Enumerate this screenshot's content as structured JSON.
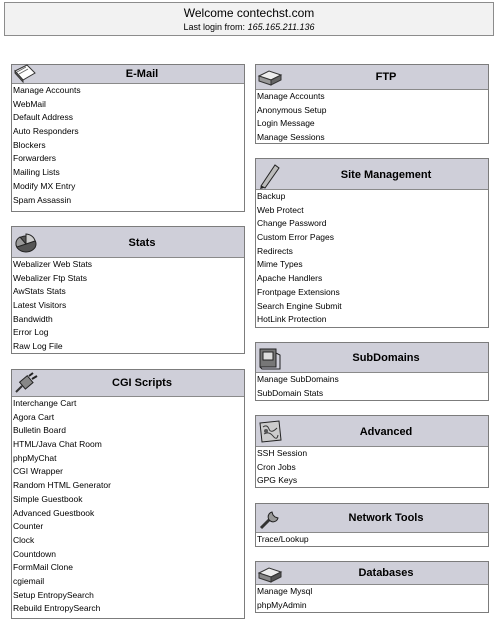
{
  "welcome": {
    "line1": "Welcome contechst.com",
    "line2_prefix": "Last login from:",
    "ip": "165.165.211.136"
  },
  "panels": {
    "email": {
      "title": "E-Mail",
      "icon": "envelope-icon",
      "items": [
        "Manage Accounts",
        "WebMail",
        "Default Address",
        "Auto Responders",
        "Blockers",
        "Forwarders",
        "Mailing Lists",
        "Modify MX Entry",
        "Spam Assassin"
      ]
    },
    "stats": {
      "title": "Stats",
      "icon": "pie-chart-icon",
      "items": [
        "Webalizer Web Stats",
        "Webalizer Ftp Stats",
        "AwStats Stats",
        "Latest Visitors",
        "Bandwidth",
        "Error Log",
        "Raw Log File"
      ]
    },
    "cgi": {
      "title": "CGI Scripts",
      "icon": "plug-icon",
      "items": [
        "Interchange Cart",
        "Agora Cart",
        "Bulletin Board",
        "HTML/Java Chat Room",
        "phpMyChat",
        "CGI Wrapper",
        "Random HTML Generator",
        "Simple Guestbook",
        "Advanced Guestbook",
        "Counter",
        "Clock",
        "Countdown",
        "FormMail Clone",
        "cgiemail",
        "Setup EntropySearch",
        "Rebuild EntropySearch"
      ]
    },
    "ftp": {
      "title": "FTP",
      "icon": "hard-drive-icon",
      "items": [
        "Manage Accounts",
        "Anonymous Setup",
        "Login Message",
        "Manage Sessions"
      ]
    },
    "site": {
      "title": "Site Management",
      "icon": "pen-icon",
      "items": [
        "Backup",
        "Web Protect",
        "Change Password",
        "Custom Error Pages",
        "Redirects",
        "Mime Types",
        "Apache Handlers",
        "Frontpage Extensions",
        "Search Engine Submit",
        "HotLink Protection"
      ]
    },
    "subdomains": {
      "title": "SubDomains",
      "icon": "subdomain-icon",
      "items": [
        "Manage SubDomains",
        "SubDomain Stats"
      ]
    },
    "advanced": {
      "title": "Advanced",
      "icon": "map-icon",
      "items": [
        "SSH Session",
        "Cron Jobs",
        "GPG Keys"
      ]
    },
    "network": {
      "title": "Network Tools",
      "icon": "wrench-icon",
      "items": [
        "Trace/Lookup"
      ]
    },
    "databases": {
      "title": "Databases",
      "icon": "database-icon",
      "items": [
        "Manage Mysql",
        "phpMyAdmin"
      ]
    }
  }
}
